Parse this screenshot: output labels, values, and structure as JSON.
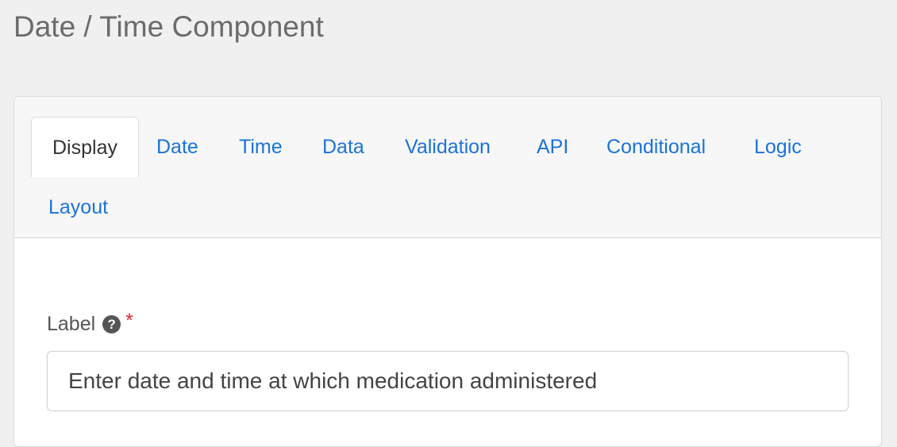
{
  "page": {
    "title": "Date / Time Component"
  },
  "tabs": [
    {
      "label": "Display",
      "active": true
    },
    {
      "label": "Date",
      "active": false
    },
    {
      "label": "Time",
      "active": false
    },
    {
      "label": "Data",
      "active": false
    },
    {
      "label": "Validation",
      "active": false
    },
    {
      "label": "API",
      "active": false
    },
    {
      "label": "Conditional",
      "active": false
    },
    {
      "label": "Logic",
      "active": false
    },
    {
      "label": "Layout",
      "active": false
    }
  ],
  "form": {
    "label_field": {
      "label": "Label",
      "help_icon": "question-circle-icon",
      "help_glyph": "?",
      "required_marker": "*",
      "value": "Enter date and time at which medication administered"
    }
  },
  "colors": {
    "link": "#1a73d9",
    "required": "#e0262b",
    "page_background": "#f0f0f0"
  }
}
